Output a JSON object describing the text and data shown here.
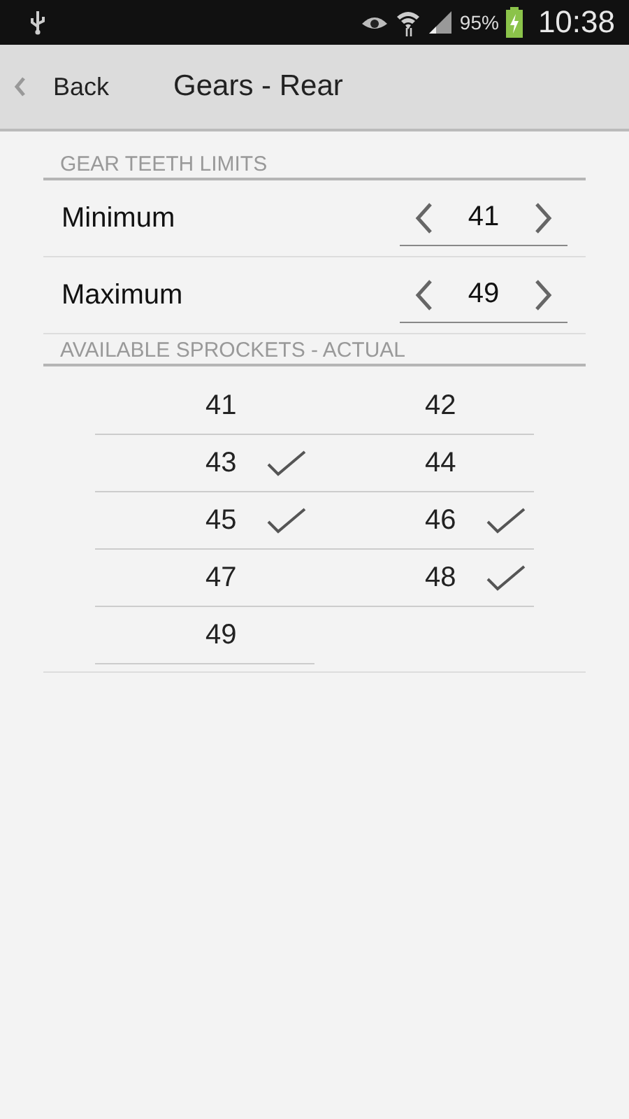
{
  "status_bar": {
    "battery": "95%",
    "time": "10:38"
  },
  "action_bar": {
    "back": "Back",
    "title": "Gears - Rear"
  },
  "sections": [
    {
      "kind": "limits",
      "header": "GEAR TEETH LIMITS",
      "rows": [
        {
          "label": "Minimum",
          "value": "41"
        },
        {
          "label": "Maximum",
          "value": "49"
        }
      ]
    },
    {
      "kind": "sprockets",
      "header": "AVAILABLE SPROCKETS - ACTUAL",
      "items": [
        {
          "label": "41",
          "checked": false
        },
        {
          "label": "42",
          "checked": false
        },
        {
          "label": "43",
          "checked": true
        },
        {
          "label": "44",
          "checked": false
        },
        {
          "label": "45",
          "checked": true
        },
        {
          "label": "46",
          "checked": true
        },
        {
          "label": "47",
          "checked": false
        },
        {
          "label": "48",
          "checked": true
        },
        {
          "label": "49",
          "checked": false
        }
      ]
    }
  ]
}
